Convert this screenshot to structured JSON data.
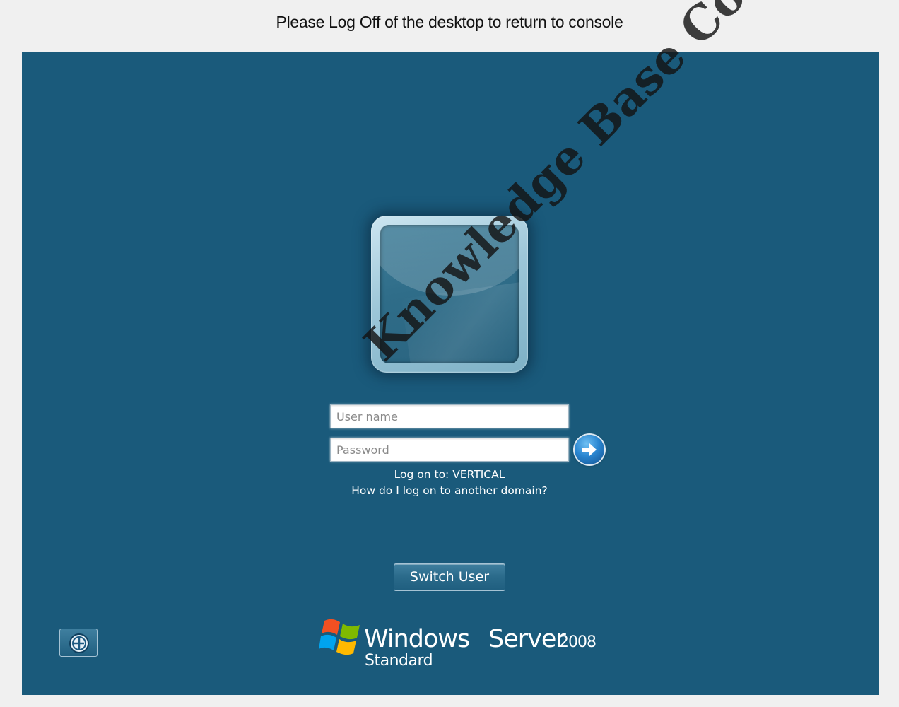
{
  "banner": {
    "message": "Please Log Off of the desktop to return to console"
  },
  "logon": {
    "username_placeholder": "User name",
    "password_placeholder": "Password",
    "logon_to": "Log on to: VERTICAL",
    "other_domain_link": "How do I log on to another domain?",
    "switch_user_label": "Switch User",
    "submit_icon": "arrow-right-icon",
    "ease_of_access_icon": "ease-of-access-icon"
  },
  "branding": {
    "product_windows": "Windows",
    "product_server": "Server",
    "product_year": "2008",
    "edition": "Standard"
  },
  "watermark": {
    "text": "Knowledge Base Content"
  },
  "colors": {
    "page_background": "#f0f0f0",
    "logon_background": "#1a5a7b",
    "text_light": "#ffffff"
  }
}
